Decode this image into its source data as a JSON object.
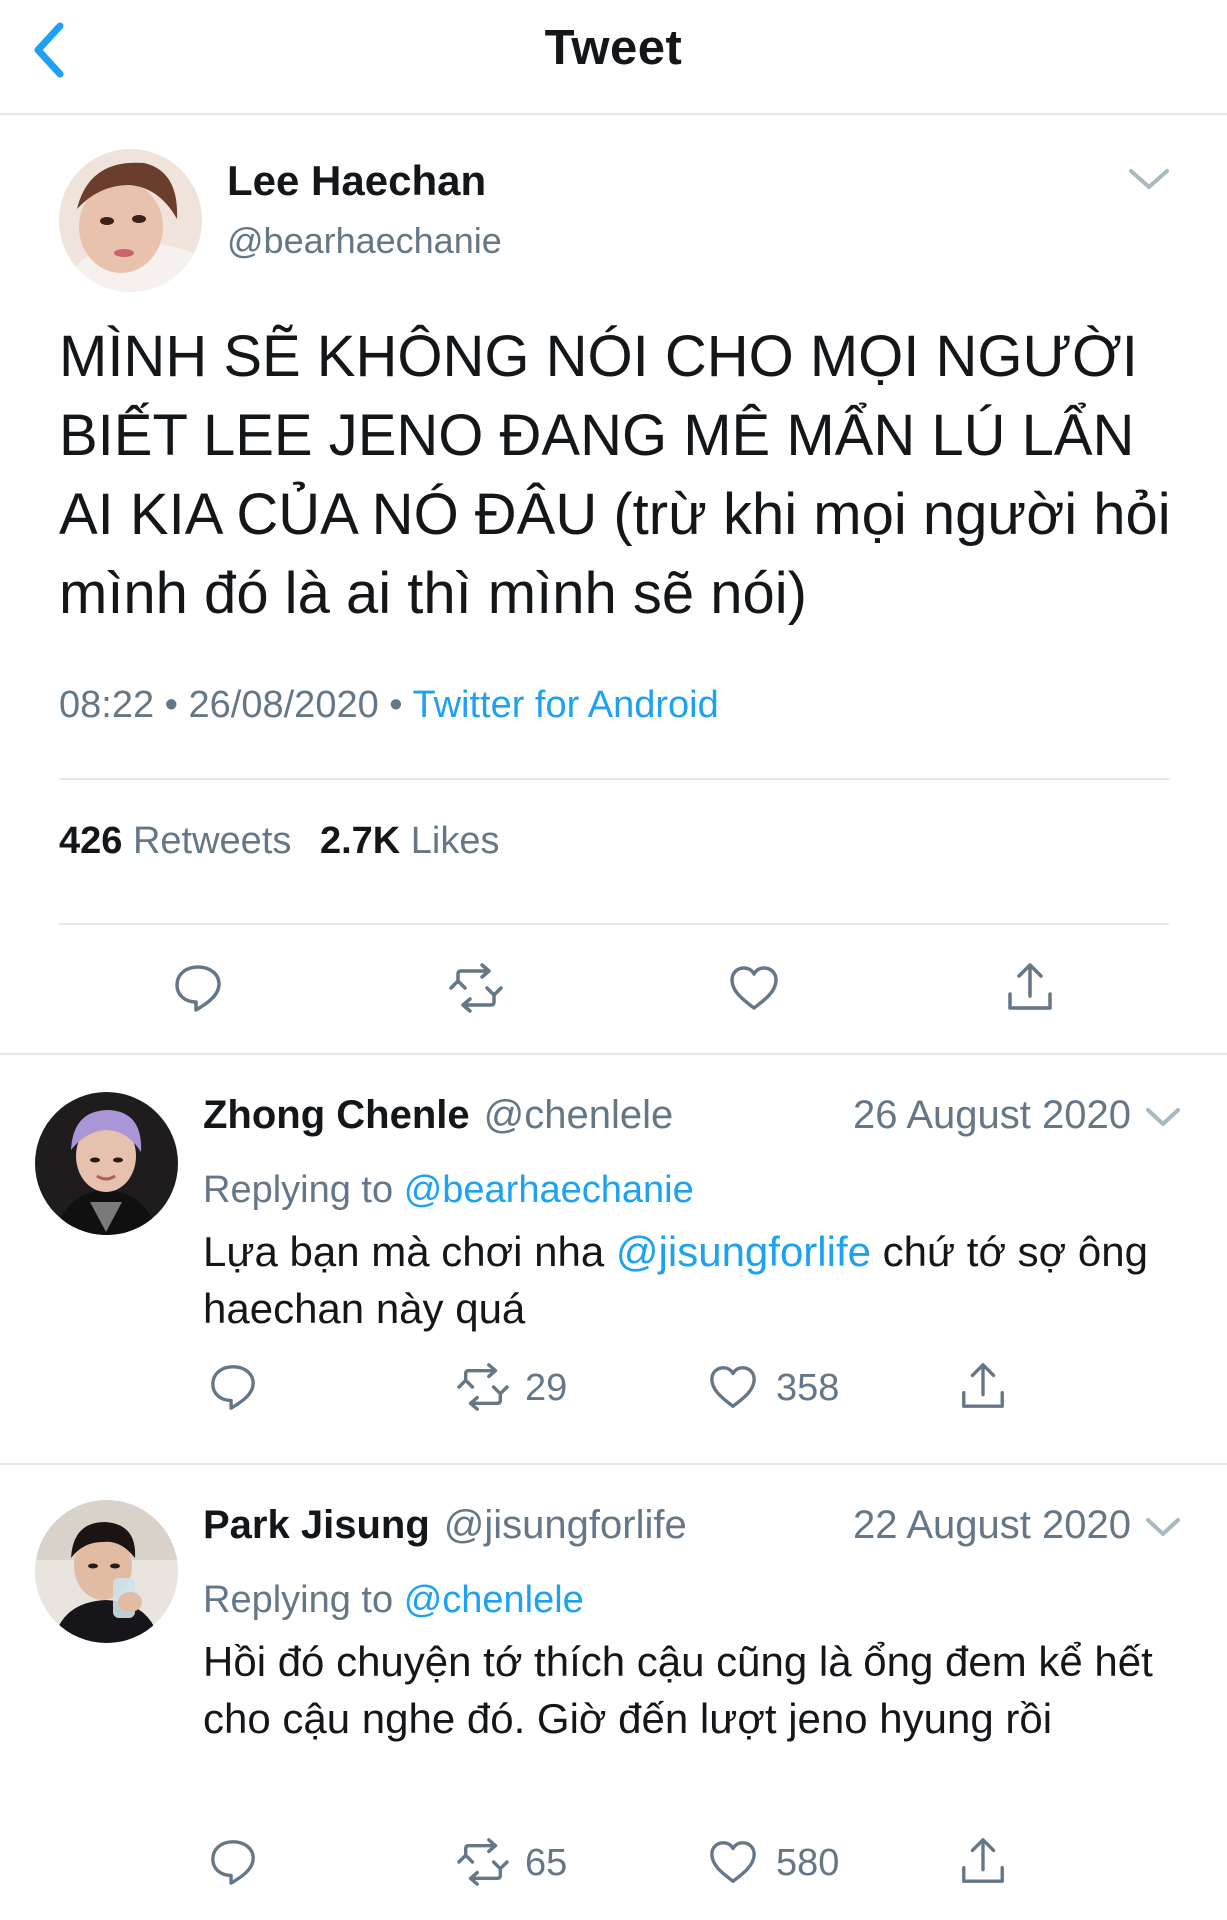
{
  "header": {
    "title": "Tweet"
  },
  "tweet": {
    "author_name": "Lee Haechan",
    "author_handle": "@bearhaechanie",
    "text": "MÌNH SẼ KHÔNG NÓI CHO MỌI NGƯỜI BIẾT LEE JENO ĐANG MÊ MẨN LÚ LẨN AI KIA CỦA NÓ ĐÂU (trừ khi mọi người hỏi mình đó là ai thì mình sẽ nói)",
    "time": "08:22",
    "date": "26/08/2020",
    "separator": "•",
    "source": "Twitter for Android",
    "retweets_count": "426",
    "retweets_label": "Retweets",
    "likes_count": "2.7K",
    "likes_label": "Likes",
    "icons": [
      "reply-icon",
      "retweet-icon",
      "like-icon",
      "share-icon"
    ]
  },
  "replies": [
    {
      "name": "Zhong Chenle",
      "handle": "@chenlele",
      "date": "26 August 2020",
      "replying_label": "Replying to",
      "replying_to": "@bearhaechanie",
      "text_before": "Lựa bạn mà chơi nha ",
      "mention": "@jisungforlife",
      "text_after": " chứ tớ sợ ông haechan này quá",
      "retweets": "29",
      "likes": "358"
    },
    {
      "name": "Park Jisung",
      "handle": "@jisungforlife",
      "date": "22 August 2020",
      "replying_label": "Replying to",
      "replying_to": "@chenlele",
      "text": "Hồi đó chuyện tớ thích cậu cũng là ổng đem kể hết cho cậu nghe đó. Giờ đến lượt jeno hyung rồi",
      "retweets": "65",
      "likes": "580"
    }
  ],
  "colors": {
    "accent": "#1da1f2",
    "icon": "#657786",
    "text": "#14171a",
    "secondary": "#657786",
    "divider": "#e1e8ed"
  }
}
